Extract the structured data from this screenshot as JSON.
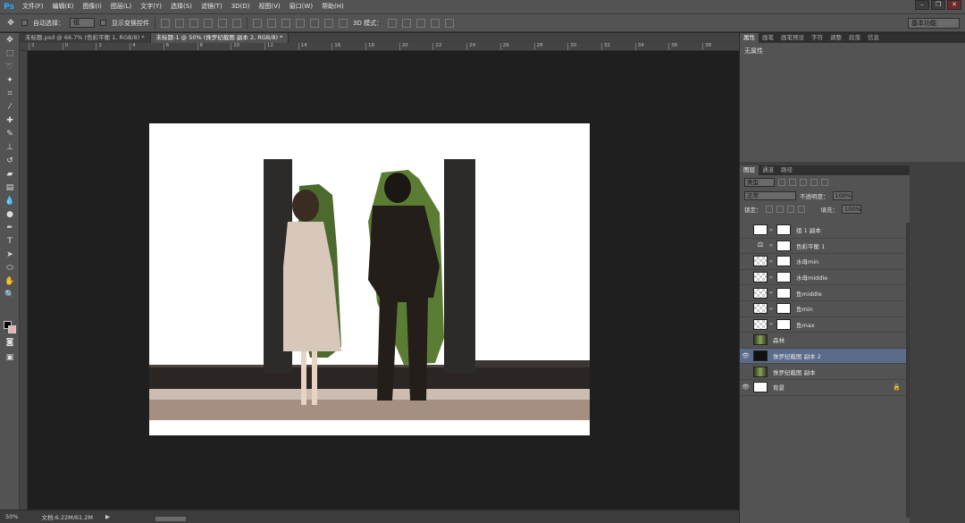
{
  "app": {
    "logo": "Ps"
  },
  "menu": [
    "文件(F)",
    "编辑(E)",
    "图像(I)",
    "图层(L)",
    "文字(Y)",
    "选择(S)",
    "滤镜(T)",
    "3D(D)",
    "视图(V)",
    "窗口(W)",
    "帮助(H)"
  ],
  "options": {
    "auto_select_label": "自动选择：",
    "auto_select_value": "组",
    "show_transform_label": "显示变换控件",
    "mode_3d_label": "3D 模式：",
    "workspace": "基本功能"
  },
  "tabs": [
    {
      "label": "未标题.psd @ 66.7% (色彩平衡 1, RGB/8) *",
      "active": false
    },
    {
      "label": "未标题-1 @ 50% (侏罗纪截图 副本 2, RGB/8) *",
      "active": true
    }
  ],
  "ruler_ticks": [
    "2",
    "0",
    "2",
    "4",
    "6",
    "8",
    "10",
    "12",
    "14",
    "16",
    "18",
    "20",
    "22",
    "24",
    "26",
    "28",
    "30",
    "32",
    "34",
    "36",
    "38"
  ],
  "status": {
    "zoom": "50%",
    "doc": "文档:6.22M/61.2M"
  },
  "properties": {
    "tabs": [
      "属性",
      "画笔",
      "画笔预设",
      "字符",
      "调整",
      "段落",
      "信息"
    ],
    "content": "无属性"
  },
  "layers_panel": {
    "tabs": [
      "图层",
      "通道",
      "路径"
    ],
    "filter_kind": "类型",
    "blend_mode": "正常",
    "opacity_label": "不透明度：",
    "opacity_value": "100%",
    "lock_label": "锁定：",
    "fill_label": "填充：",
    "fill_value": "100%",
    "layers": [
      {
        "name": "组 1 副本",
        "visible": false,
        "thumb": "white",
        "mask": true,
        "selected": false
      },
      {
        "name": "色彩平衡 1",
        "visible": false,
        "thumb": "adjust",
        "mask": true,
        "selected": false
      },
      {
        "name": "水母min",
        "visible": false,
        "thumb": "checker",
        "mask": true,
        "selected": false
      },
      {
        "name": "水母middle",
        "visible": false,
        "thumb": "checker",
        "mask": true,
        "selected": false
      },
      {
        "name": "鱼middle",
        "visible": false,
        "thumb": "checker",
        "mask": true,
        "selected": false
      },
      {
        "name": "鱼min",
        "visible": false,
        "thumb": "checker",
        "mask": true,
        "selected": false
      },
      {
        "name": "鱼max",
        "visible": false,
        "thumb": "checker",
        "mask": true,
        "selected": false
      },
      {
        "name": "森林",
        "visible": false,
        "thumb": "photo",
        "mask": false,
        "selected": false
      },
      {
        "name": "侏罗纪截图 副本 2",
        "visible": true,
        "thumb": "dark",
        "mask": false,
        "selected": true
      },
      {
        "name": "侏罗纪截图 副本",
        "visible": false,
        "thumb": "photo",
        "mask": false,
        "selected": false
      },
      {
        "name": "背景",
        "visible": true,
        "thumb": "white",
        "mask": false,
        "selected": false,
        "locked": true
      }
    ]
  }
}
